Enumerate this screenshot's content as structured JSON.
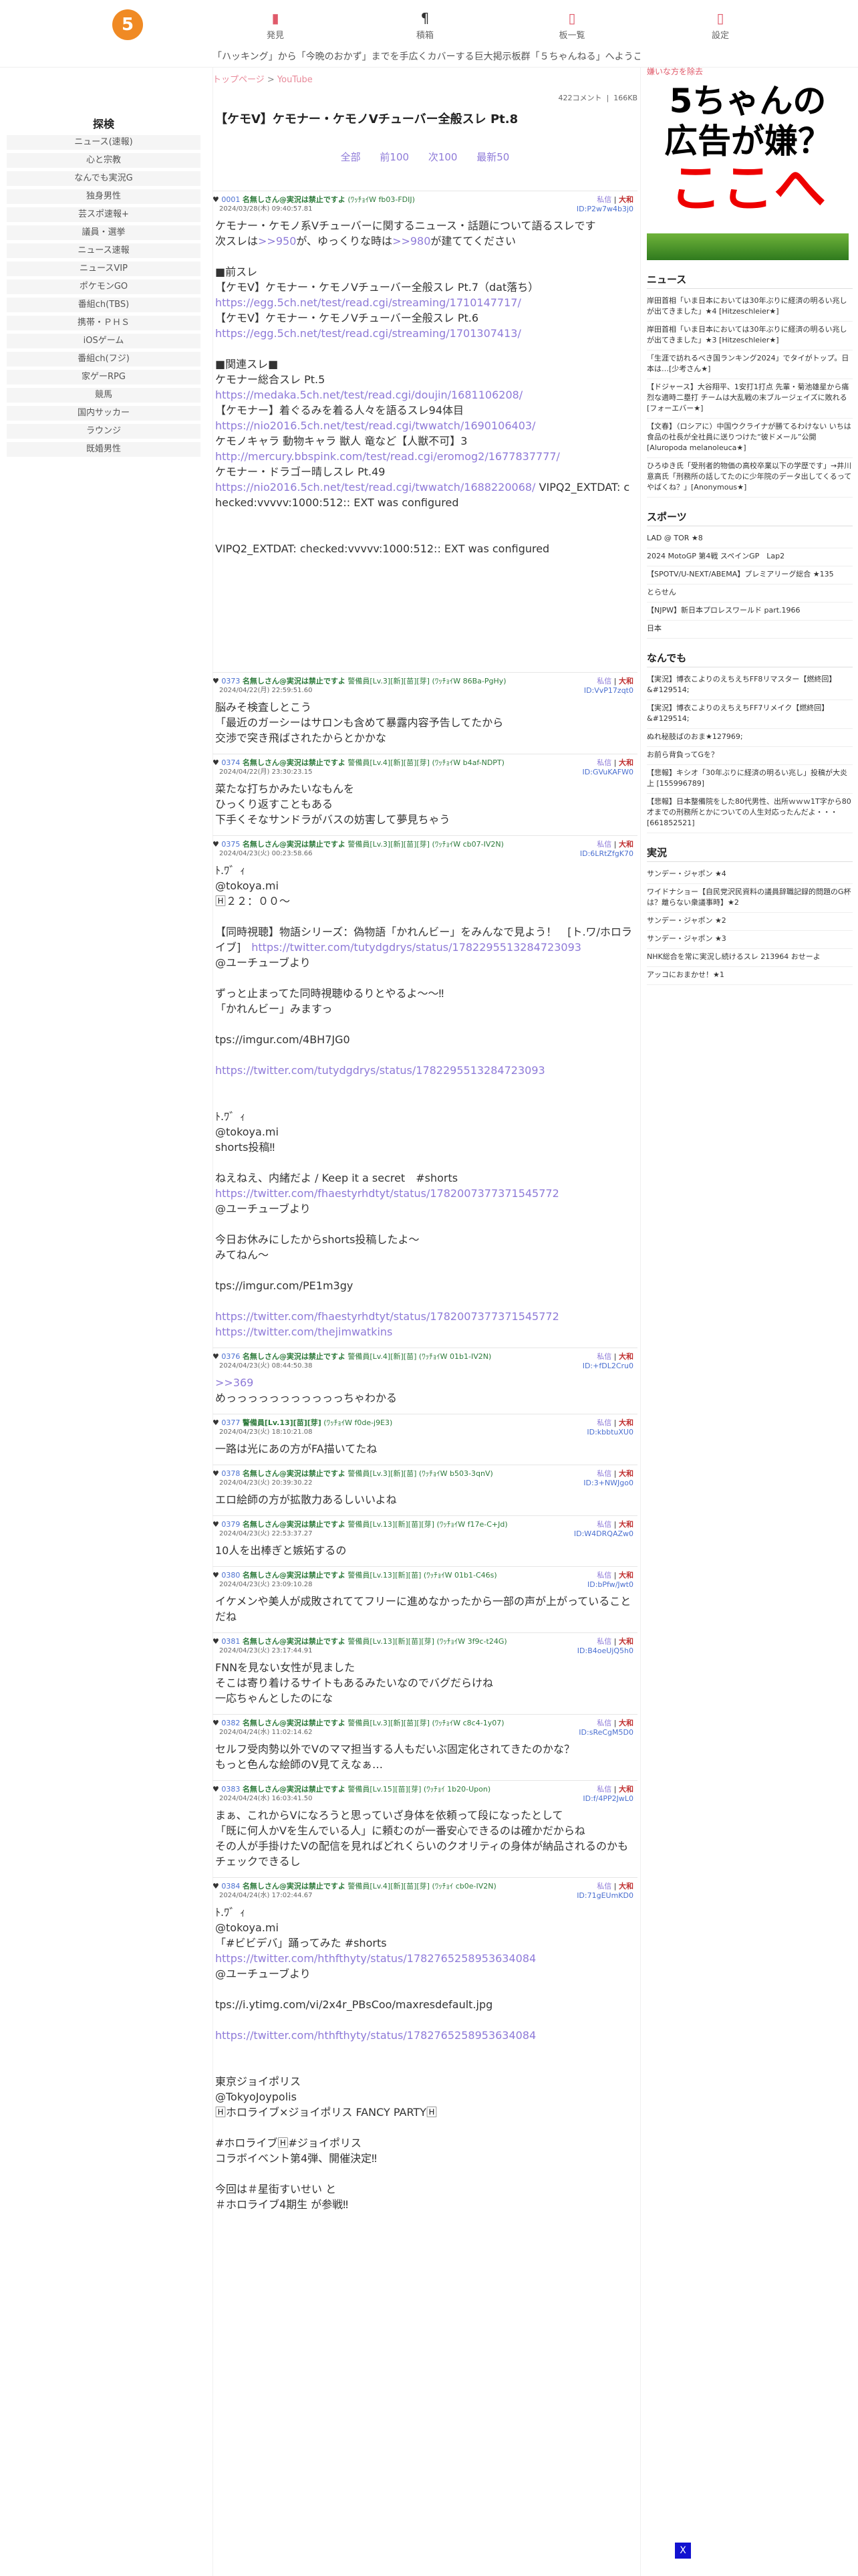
{
  "header": {
    "logo": "5",
    "nav": [
      {
        "icon": "▮",
        "label": "発見"
      },
      {
        "icon": "¶",
        "label": "積箱"
      },
      {
        "icon": "▯",
        "label": "板一覧"
      },
      {
        "icon": "▯",
        "label": "設定"
      }
    ],
    "ticker": "「ハッキング」から「今晩のおかず」までを手広くカバーする巨大掲示板群「５ちゃんねる」へようこそ！"
  },
  "leftnav": {
    "title": "探検",
    "items": [
      "ニュース(速報)",
      "心と宗教",
      "なんでも実況G",
      "独身男性",
      "芸スポ速報+",
      "議員・選挙",
      "ニュース速報",
      "ニュースVIP",
      "ポケモンGO",
      "番組ch(TBS)",
      "携帯・ＰＨＳ",
      "iOSゲーム",
      "番組ch(フジ)",
      "家ゲーRPG",
      "競馬",
      "国内サッカー",
      "ラウンジ",
      "既婚男性"
    ]
  },
  "main": {
    "breadcrumb": [
      "トップページ",
      "YouTube"
    ],
    "meta": {
      "comments": "422コメント",
      "size": "166KB"
    },
    "title": "【ケモV】ケモナー・ケモノVチューバー全般スレ Pt.8",
    "pagenav": [
      "全部",
      "前100",
      "次100",
      "最新50"
    ],
    "posts": [
      {
        "num": "0001",
        "name": "名無しさん@実況は禁止ですよ",
        "trip": "(ﾜｯﾁｮｲW fb03-FDIJ)",
        "date": "2024/03/28(木) 09:40:57.81",
        "id": "ID:P2w7w4b3j0",
        "body": "ケモナー・ケモノ系Vチューバーに関するニュース・話題について語るスレです\n次スレは>>950が、ゆっくりな時は>>980が建ててください\n\n■前スレ\n【ケモV】ケモナー・ケモノVチューバー全般スレ Pt.7（dat落ち）\nhttps://egg.5ch.net/test/read.cgi/streaming/1710147717/\n【ケモV】ケモナー・ケモノVチューバー全般スレ Pt.6\nhttps://egg.5ch.net/test/read.cgi/streaming/1701307413/\n\n■関連スレ■\nケモナー総合スレ Pt.5\nhttps://medaka.5ch.net/test/read.cgi/doujin/1681106208/\n【ケモナー】着ぐるみを着る人々を語るスレ94体目\nhttps://nio2016.5ch.net/test/read.cgi/twwatch/1690106403/\nケモノキャラ 動物キャラ 獣人 竜など【人獣不可】3\nhttp://mercury.bbspink.com/test/read.cgi/eromog2/1677837777/\nケモナー・ドラゴー晴しスレ Pt.49\nhttps://nio2016.5ch.net/test/read.cgi/twwatch/1688220068/ VIPQ2_EXTDAT: checked:vvvvv:1000:512:: EXT was configured\n\n\nVIPQ2_EXTDAT: checked:vvvvv:1000:512:: EXT was configured\n\n\n\n\n\n\n\n"
      },
      {
        "num": "0373",
        "name": "名無しさん@実況は禁止ですよ",
        "trip": "警備員[Lv.3][新][苗][芽] (ﾜｯﾁｮｲW 86Ba-PgHy)",
        "date": "2024/04/22(月) 22:59:51.60",
        "id": "ID:VvP17zqt0",
        "body": "脳みそ検査しとこう\n「最近のガーシーはサロンも含めて暴露内容予告してたから\n交渉で突き飛ばされたからとかかな"
      },
      {
        "num": "0374",
        "name": "名無しさん@実況は禁止ですよ",
        "trip": "警備員[Lv.4][新][苗][芽] (ﾜｯﾁｮｲW b4af-NDPT)",
        "date": "2024/04/22(月) 23:30:23.15",
        "id": "ID:GVuKAFW0",
        "body": "菜たな打ちかみたいなもんを\nひっくり返すこともある\n下手くそなサンドラがバスの妨害して夢見ちゃう"
      },
      {
        "num": "0375",
        "name": "名無しさん@実況は禁止ですよ",
        "trip": "警備員[Lv.3][新][苗][芽] (ﾜｯﾁｮｲW cb07-IV2N)",
        "date": "2024/04/23(火) 00:23:58.66",
        "id": "ID:6LRtZfgK70",
        "body": "ﾄ.ﾜ゛ｨ\n@tokoya.mi\n🄷２２：００〜\n\n【同時視聴】物語シリーズ：偽物語「かれんビー」をみんなで見よう！　[ト.ワ/ホロライブ]　https://twitter.com/tutydgdrys/status/1782295513284723093\n@ユーチューブより\n\nずっと止まってた同時視聴ゆるりとやるよ〜〜‼\n「かれんビー」みますっ\n\ntps://imgur.com/4BH7JG0\n\nhttps://twitter.com/tutydgdrys/status/1782295513284723093\n\n\nﾄ.ﾜ゛ｨ\n@tokoya.mi\nshorts投稿‼\n\nねえねえ、内緒だよ / Keep it a secret　#shorts\nhttps://twitter.com/fhaestyrhdtyt/status/1782007377371545772\n@ユーチューブより\n\n今日お休みにしたからshorts投稿したよ〜\nみてねん〜\n\ntps://imgur.com/PE1m3gy\n\nhttps://twitter.com/fhaestyrhdtyt/status/1782007377371545772\nhttps://twitter.com/thejimwatkins"
      },
      {
        "num": "0376",
        "name": "名無しさん@実況は禁止ですよ",
        "trip": "警備員[Lv.4][新][苗] (ﾜｯﾁｮｲW 01b1-IV2N)",
        "date": "2024/04/23(火) 08:44:50.38",
        "id": "ID:+fDL2Cru0",
        "body": ">>369\nめっっっっっっっっっっっちゃわかる"
      },
      {
        "num": "0377",
        "name": "警備員[Lv.13][苗][芽]",
        "trip": "(ﾜｯﾁｮｲW f0de-j9E3)",
        "date": "2024/04/23(火) 18:10:21.08",
        "id": "ID:kbbtuXU0",
        "body": "一路は光にあの方がFA描いてたね"
      },
      {
        "num": "0378",
        "name": "名無しさん@実況は禁止ですよ",
        "trip": "警備員[Lv.3][新][苗] (ﾜｯﾁｮｲW b503-3qnV)",
        "date": "2024/04/23(火) 20:39:30.22",
        "id": "ID:3+NWJgo0",
        "body": "エロ絵師の方が拡散力あるしいいよね"
      },
      {
        "num": "0379",
        "name": "名無しさん@実況は禁止ですよ",
        "trip": "警備員[Lv.13][新][苗][芽] (ﾜｯﾁｮｲW f17e-C+Jd)",
        "date": "2024/04/23(火) 22:53:37.27",
        "id": "ID:W4DRQAZw0",
        "body": "10人を出棒ぎと嫉妬するの"
      },
      {
        "num": "0380",
        "name": "名無しさん@実況は禁止ですよ",
        "trip": "警備員[Lv.13][新][苗] (ﾜｯﾁｮｲW 01b1-C46s)",
        "date": "2024/04/23(火) 23:09:10.28",
        "id": "ID:bPfw/Jwt0",
        "body": "イケメンや美人が成敗されててフリーに進めなかったから一部の声が上がっていることだね"
      },
      {
        "num": "0381",
        "name": "名無しさん@実況は禁止ですよ",
        "trip": "警備員[Lv.13][新][苗][芽] (ﾜｯﾁｮｲW 3f9c-t24G)",
        "date": "2024/04/23(火) 23:17:44.91",
        "id": "ID:B4oeUjQ5h0",
        "body": "FNNを見ない女性が見ました\nそこは寄り着けるサイトもあるみたいなのでバグだらけね\n一応ちゃんとしたのにな"
      },
      {
        "num": "0382",
        "name": "名無しさん@実況は禁止ですよ",
        "trip": "警備員[Lv.3][新][苗][芽] (ﾜｯﾁｮｲW c8c4-1y07)",
        "date": "2024/04/24(水) 11:02:14.62",
        "id": "ID:sReCgM5D0",
        "body": "セルフ受肉勢以外でVのママ担当する人もだいぶ固定化されてきたのかな？\nもっと色んな絵師のV見てえなぁ…"
      },
      {
        "num": "0383",
        "name": "名無しさん@実況は禁止ですよ",
        "trip": "警備員[Lv.15][苗][芽] (ﾜｯﾁｮｲ 1b20-Upon)",
        "date": "2024/04/24(水) 16:03:41.50",
        "id": "ID:f/4PP2JwL0",
        "body": "まぁ、これからVになろうと思っていざ身体を依頼って段になったとして\n「既に何人かVを生んでいる人」に頼むのが一番安心できるのは確かだからね\nその人が手掛けたVの配信を見ればどれくらいのクオリティの身体が納品されるのかもチェックできるし"
      },
      {
        "num": "0384",
        "name": "名無しさん@実況は禁止ですよ",
        "trip": "警備員[Lv.4][新][苗][芽] (ﾜｯﾁｮｲ cb0e-IV2N)",
        "date": "2024/04/24(水) 17:02:44.67",
        "id": "ID:71gEUmKD0",
        "body": "ﾄ.ﾜ゛ｨ\n@tokoya.mi\n「#ビビデバ」踊ってみた #shorts\nhttps://twitter.com/hthfthyty/status/1782765258953634084\n@ユーチューブより\n\ntps://i.ytimg.com/vi/2x4r_PBsCoo/maxresdefault.jpg\n\nhttps://twitter.com/hthfthyty/status/1782765258953634084\n\n\n東京ジョイポリス\n@TokyoJoypolis\n🄷ホロライブ×ジョイポリス FANCY PARTY🄷\n\n#ホロライブ🄷#ジョイポリス\nコラボイベント第4弾、開催決定‼\n\n今回は＃星街すいせい と\n＃ホロライブ4期生 が参戦‼"
      }
    ]
  },
  "right": {
    "ad_label": "嫌いな方を除去",
    "ad": {
      "line1": "5ちゃんの",
      "line2": "広告が嫌？",
      "line3": "ここへ"
    },
    "sections": [
      {
        "title": "ニュース",
        "items": [
          "岸田首相「いま日本においては30年ぶりに経済の明るい兆しが出てきました」★4 [Hitzeschleier★]",
          "岸田首相「いま日本においては30年ぶりに経済の明るい兆しが出てきました」★3 [Hitzeschleier★]",
          "「生涯で訪れるべき国ランキング2024」でタイがトップ。日本は…[少考さん★]",
          "【ドジャース】大谷翔平、1安打1打点 先輩・菊池雄星から痛烈な適時二塁打 チームは大乱戦の末ブルージェイズに敗れる [フォーエバー★]",
          "【文春】（ロシアに）中国ウクライナが勝てるわけない いちは食品の社長が全社員に送りつけた“彼ドメール”公開 [Aluropoda melanoleuca★]",
          "ひろゆき氏「受刑者的物価の高校卒業以下の学歴です」→井川意高氏「刑務所の話してたのに少年院のデータ出してくるってやばくね？」[Anonymous★]"
        ]
      },
      {
        "title": "スポーツ",
        "items": [
          "LAD @ TOR ★8",
          "2024 MotoGP 第4戦 スペインGP　Lap2",
          "【SPOTV/U-NEXT/ABEMA】プレミアリーグ総合 ★135",
          "とらせん",
          "【NJPW】新日本プロレスワールド part.1966",
          "日本"
        ]
      },
      {
        "title": "なんでも",
        "items": [
          "【実況】博衣こよりのえちえちFF8リマスター【燃終回】&#129514;",
          "【実況】博衣こよりのえちえちFF7リメイク【燃終回】&#129514;",
          "ぬれ秘肢ばのおま★127969;",
          "お前ら背負ってGを？",
          "【悲報】キシオ「30年ぶりに経済の明るい兆し」投稿が大炎上 [155996789]",
          "【悲報】日本整備院をした80代男性、出所ｗｗｗ1T字から80才までの刑務所とかについての人生対応ったんだよ・・・[661852521]"
        ]
      },
      {
        "title": "実況",
        "items": [
          "サンデー・ジャポン ★4",
          "ワイドナショー【自民党沢民資料の議員辞職記録的問題のG杯は？離らない衆議事時】★2",
          "サンデー・ジャポン ★2",
          "サンデー・ジャポン ★3",
          "NHK総合を常に実況し続けるスレ 213964 おせーよ",
          "アッコにおまかせ！★1"
        ]
      }
    ]
  }
}
